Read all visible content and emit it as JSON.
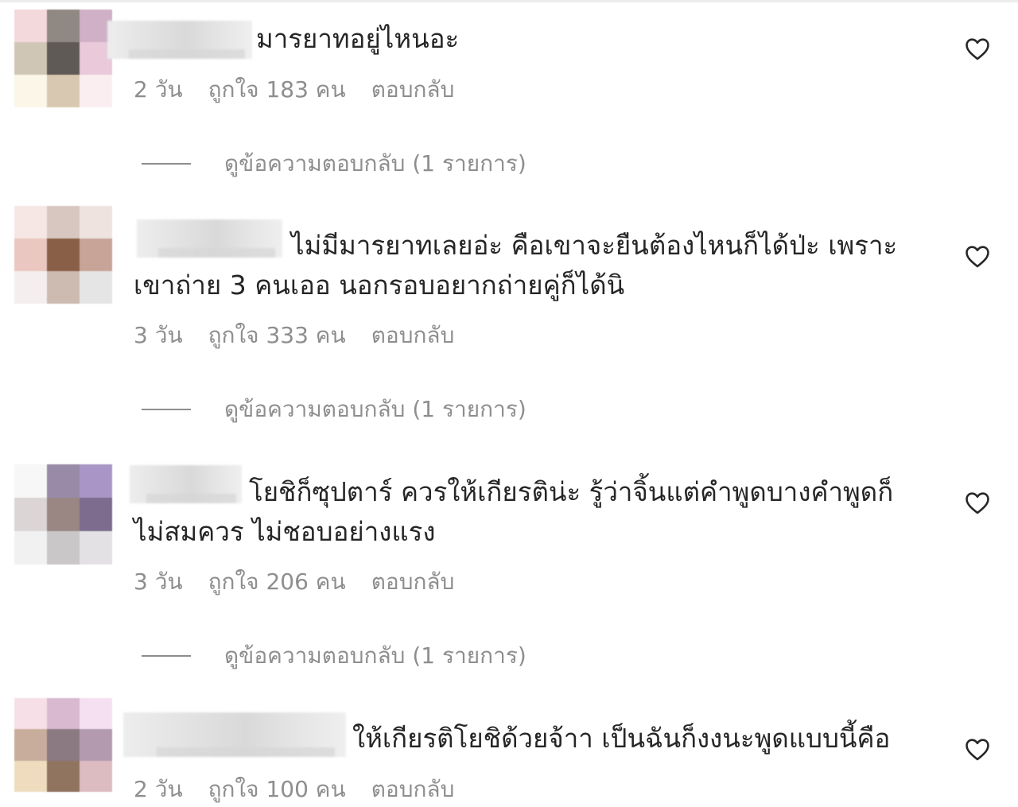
{
  "comments": [
    {
      "text_line1": "มารยาทอยู่ไหนอะ",
      "text_line2": "",
      "time": "2 วัน",
      "likes": "ถูกใจ 183 คน",
      "reply": "ตอบกลับ",
      "view_replies": "ดูข้อความตอบกลับ (1 รายการ)",
      "avatar_colors": [
        "#f3d9dc",
        "#8f8883",
        "#cfb0c6",
        "#cfc6b6",
        "#5f5a55",
        "#e9c9da",
        "#fcf6e9",
        "#d8c8b1",
        "#fbeef0"
      ]
    },
    {
      "text_line1": "ไม่มีมารยาทเลยอ่ะ คือเขาจะยืนต้องไหนก็ได้ป่ะ เพราะ",
      "text_line2": "เขาถ่าย 3 คนเออ นอกรอบอยากถ่ายคู่ก็ได้นิ",
      "time": "3 วัน",
      "likes": "ถูกใจ 333 คน",
      "reply": "ตอบกลับ",
      "view_replies": "ดูข้อความตอบกลับ (1 รายการ)",
      "avatar_colors": [
        "#f6e6e4",
        "#d8c7c0",
        "#eee3df",
        "#eac7c0",
        "#8a5f47",
        "#c7a497",
        "#f4eeee",
        "#cdbab1",
        "#e5e5e5"
      ]
    },
    {
      "text_line1": "โยชิก็ซุปตาร์ ควรให้เกียรติน่ะ รู้ว่าจิ้นแต่คำพูดบางคำพูดก็",
      "text_line2": "ไม่สมควร ไม่ชอบอย่างแรง",
      "time": "3 วัน",
      "likes": "ถูกใจ 206 คน",
      "reply": "ตอบกลับ",
      "view_replies": "ดูข้อความตอบกลับ (1 รายการ)",
      "avatar_colors": [
        "#f7f7f7",
        "#998aa8",
        "#a996c6",
        "#dbd5d5",
        "#9a8683",
        "#7d6c8e",
        "#f1f1f1",
        "#c9c7c7",
        "#e3e1e3"
      ]
    },
    {
      "text_line1": "ให้เกียรติโยชิด้วยจ้าา เป็นฉันก็งงนะพูดแบบนี้คือ",
      "text_line2": "",
      "time": "2 วัน",
      "likes": "ถูกใจ 100 คน",
      "reply": "ตอบกลับ",
      "view_replies": "",
      "avatar_colors": [
        "#f6dfe6",
        "#d9b9cf",
        "#f4e0f1",
        "#c9ad9c",
        "#8c7a83",
        "#b39aaf",
        "#efdcbf",
        "#907460",
        "#dcbcc0"
      ]
    }
  ],
  "icons": {
    "like": "heart-outline-icon"
  }
}
